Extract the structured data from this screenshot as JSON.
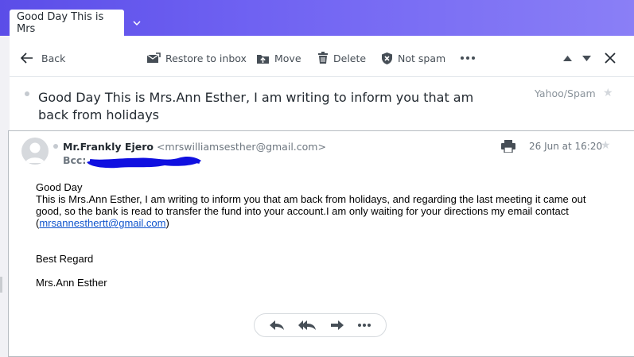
{
  "tab": {
    "title": "Good Day This is Mrs"
  },
  "toolbar": {
    "back_label": "Back",
    "restore_label": "Restore to inbox",
    "move_label": "Move",
    "delete_label": "Delete",
    "not_spam_label": "Not spam"
  },
  "message": {
    "subject": "Good Day This is Mrs.Ann Esther, I am writing to inform you that am back from holidays",
    "folder": "Yahoo/Spam",
    "sender_name": "Mr.Frankly Ejero",
    "sender_email": "<mrswilliamsesther@gmail.com>",
    "bcc_label": "Bcc:",
    "date": "26 Jun at 16:20",
    "body": {
      "greeting": "Good Day",
      "paragraph": "This is Mrs.Ann Esther, I am writing to inform you that am back from holidays, and regarding the last meeting it came out good, so the bank is read to transfer the fund into your account.I am only waiting for your directions  my email contact",
      "open_paren": "(",
      "contact_link": "mrsannesthertt@gmail.com",
      "close_paren": ")",
      "closing": "Best Regard",
      "signature": "Mrs.Ann Esther"
    }
  },
  "colors": {
    "accent": "#6001d2",
    "link": "#1155cc",
    "redaction": "#1010e0"
  }
}
